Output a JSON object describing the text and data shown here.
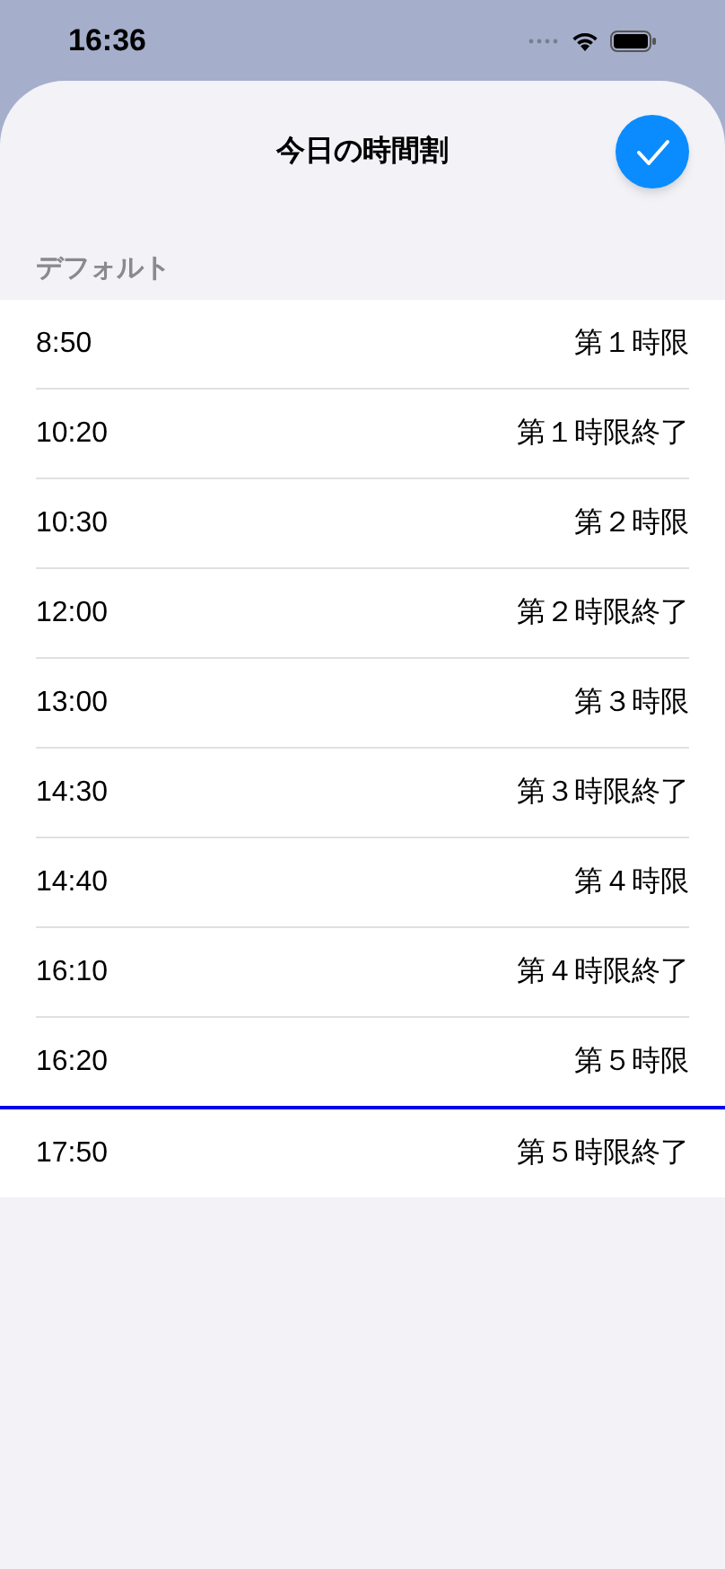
{
  "status_bar": {
    "time": "16:36"
  },
  "sheet": {
    "title": "今日の時間割"
  },
  "section": {
    "header": "デフォルト"
  },
  "rows": [
    {
      "time": "8:50",
      "label": "第１時限",
      "now_line_after": false
    },
    {
      "time": "10:20",
      "label": "第１時限終了",
      "now_line_after": false
    },
    {
      "time": "10:30",
      "label": "第２時限",
      "now_line_after": false
    },
    {
      "time": "12:00",
      "label": "第２時限終了",
      "now_line_after": false
    },
    {
      "time": "13:00",
      "label": "第３時限",
      "now_line_after": false
    },
    {
      "time": "14:30",
      "label": "第３時限終了",
      "now_line_after": false
    },
    {
      "time": "14:40",
      "label": "第４時限",
      "now_line_after": false
    },
    {
      "time": "16:10",
      "label": "第４時限終了",
      "now_line_after": false
    },
    {
      "time": "16:20",
      "label": "第５時限",
      "now_line_after": true
    },
    {
      "time": "17:50",
      "label": "第５時限終了",
      "now_line_after": false
    }
  ]
}
